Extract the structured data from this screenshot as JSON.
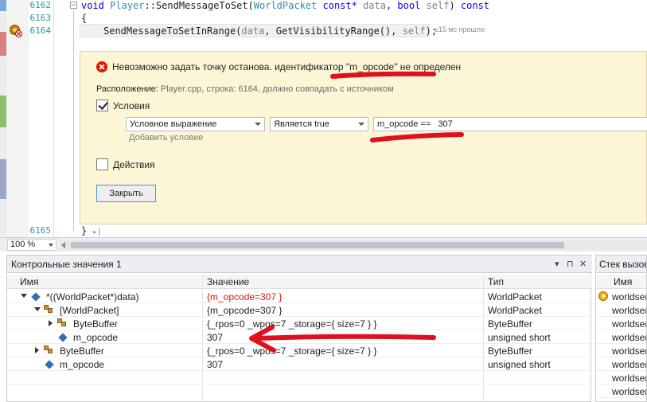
{
  "editor": {
    "lines": [
      "6162",
      "6163",
      "6164",
      "6165"
    ],
    "code_l1": {
      "kw": "void",
      "cls": "Player",
      "sep": "::",
      "fn": "SendMessageToSet(",
      "t1": "WorldPacket",
      "k2": " const*",
      "p1": " data",
      "c1": ", ",
      "k3": "bool",
      "p2": " self",
      "end": ") ",
      "k4": "const"
    },
    "code_l2": "{",
    "code_l3": {
      "fn": "SendMessageToSetInRange(",
      "p1": "data",
      "mid": ", GetVisibilityRange(), ",
      "p2": "self",
      "end": ");"
    },
    "perf_tip": "≤15 мс прошло",
    "code_l4": "}",
    "run_glyph": "▸|"
  },
  "breakpoint": {
    "error": "Невозможно задать точку останова. идентификатор \"m_opcode\" не определен",
    "location_label": "Расположение:",
    "location_value": "Player.cpp, строка: 6164, должно совпадать с источником",
    "conditions_label": "Условия",
    "condition_type": "Условное выражение",
    "condition_op": "Является true",
    "condition_expr": "m_opcode ==   307",
    "add_condition": "Добавить условие",
    "actions_label": "Действия",
    "close_button": "Закрыть"
  },
  "zoom": "100 %",
  "watch": {
    "title": "Контрольные значения 1",
    "icons": {
      "dropdown": "▾",
      "pin": "⊓",
      "close": "✕"
    },
    "columns": [
      "Имя",
      "Значение",
      "Тип"
    ],
    "rows": [
      {
        "name": "*((WorldPacket*)data)",
        "value": "{m_opcode=307 }",
        "type": "WorldPacket"
      },
      {
        "name": "[WorldPacket]",
        "value": "{m_opcode=307 }",
        "type": "WorldPacket"
      },
      {
        "name": "ByteBuffer",
        "value": "{_rpos=0 _wpos=7 _storage={ size=7 } }",
        "type": "ByteBuffer"
      },
      {
        "name": "m_opcode",
        "value": "307",
        "type": "unsigned short"
      },
      {
        "name": "ByteBuffer",
        "value": "{_rpos=0 _wpos=7 _storage={ size=7 } }",
        "type": "ByteBuffer"
      },
      {
        "name": "m_opcode",
        "value": "307",
        "type": "unsigned short"
      }
    ]
  },
  "callstack": {
    "title": "Стек вызовов",
    "column": "Имя",
    "rows": [
      "worldserver",
      "worldserver",
      "worldserver",
      "worldserver",
      "worldserver",
      "worldserver",
      "worldserver",
      "worldserver"
    ]
  },
  "colors": {
    "error_red": "#e51400",
    "annotation_red": "#e0101c",
    "panel_yellow": "#fcf6d6",
    "accent_blue": "#2b91af"
  }
}
